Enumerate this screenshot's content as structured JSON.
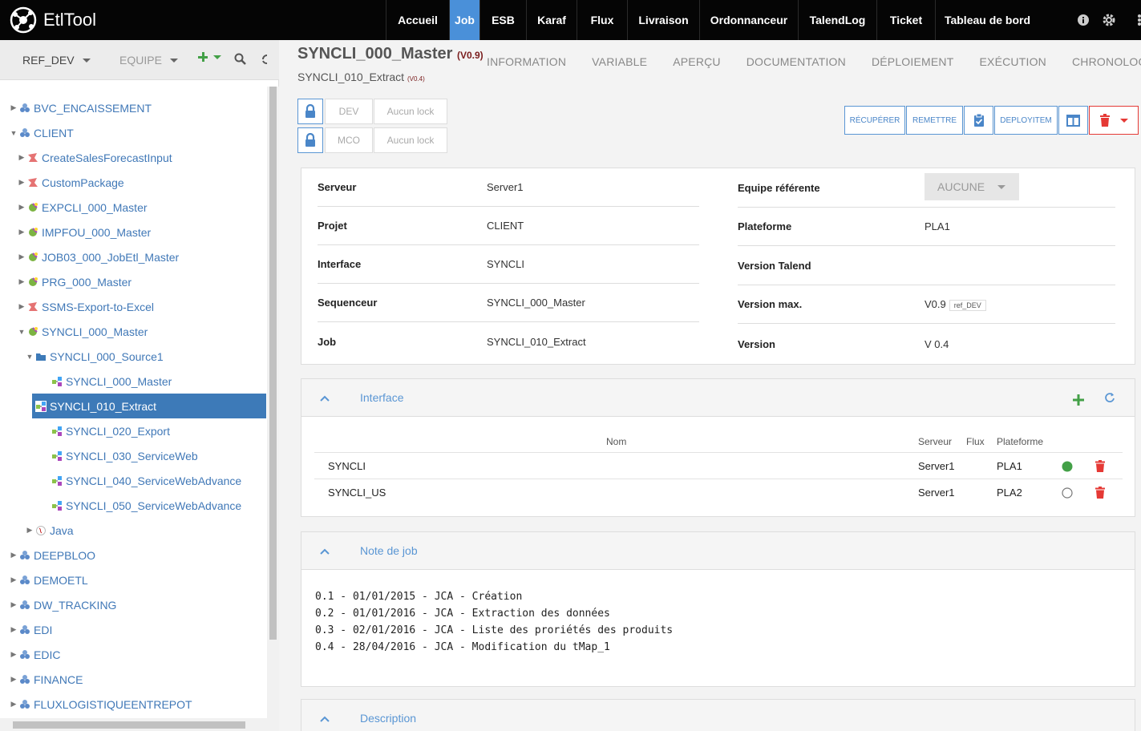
{
  "app": {
    "name": "EtlTool"
  },
  "nav": {
    "items": [
      "Accueil",
      "Job",
      "ESB",
      "Karaf",
      "Flux",
      "Livraison",
      "Ordonnanceur",
      "TalendLog",
      "Ticket",
      "Tableau de bord"
    ],
    "active": "Job",
    "icons": [
      "info-icon",
      "gear-icon"
    ]
  },
  "sidebar": {
    "branch_label": "REF_DEV",
    "team_label": "EQUIPE",
    "tree": [
      {
        "label": "BVC_ENCAISSEMENT",
        "icon": "project-icon",
        "expanded": false
      },
      {
        "label": "CLIENT",
        "icon": "project-icon",
        "expanded": true
      },
      {
        "label": "CreateSalesForecastInput",
        "icon": "esb-icon",
        "expanded": false
      },
      {
        "label": "CustomPackage",
        "icon": "esb-icon",
        "expanded": false
      },
      {
        "label": "EXPCLI_000_Master",
        "icon": "master-icon",
        "expanded": false
      },
      {
        "label": "IMPFOU_000_Master",
        "icon": "master-icon",
        "expanded": false
      },
      {
        "label": "JOB03_000_JobEtl_Master",
        "icon": "master-icon",
        "expanded": false
      },
      {
        "label": "PRG_000_Master",
        "icon": "master-icon",
        "expanded": false
      },
      {
        "label": "SSMS-Export-to-Excel",
        "icon": "esb-icon",
        "expanded": false
      },
      {
        "label": "SYNCLI_000_Master",
        "icon": "master-icon",
        "expanded": true
      },
      {
        "label": "SYNCLI_000_Source1",
        "icon": "folder-icon",
        "expanded": true
      },
      {
        "label": "SYNCLI_000_Master",
        "icon": "job-icon",
        "expanded": false
      },
      {
        "label": "SYNCLI_010_Extract",
        "icon": "job-icon",
        "expanded": false,
        "selected": true
      },
      {
        "label": "SYNCLI_020_Export",
        "icon": "job-icon",
        "expanded": false
      },
      {
        "label": "SYNCLI_030_ServiceWeb",
        "icon": "job-icon",
        "expanded": false
      },
      {
        "label": "SYNCLI_040_ServiceWebAdvance",
        "icon": "job-icon",
        "expanded": false
      },
      {
        "label": "SYNCLI_050_ServiceWebAdvance",
        "icon": "job-icon",
        "expanded": false
      },
      {
        "label": "Java",
        "icon": "java-icon",
        "expanded": false
      },
      {
        "label": "DEEPBLOO",
        "icon": "project-icon",
        "expanded": false
      },
      {
        "label": "DEMOETL",
        "icon": "project-icon",
        "expanded": false
      },
      {
        "label": "DW_TRACKING",
        "icon": "project-icon",
        "expanded": false
      },
      {
        "label": "EDI",
        "icon": "project-icon",
        "expanded": false
      },
      {
        "label": "EDIC",
        "icon": "project-icon",
        "expanded": false
      },
      {
        "label": "FINANCE",
        "icon": "project-icon",
        "expanded": false
      },
      {
        "label": "FLUXLOGISTIQUEENTREPOT",
        "icon": "project-icon",
        "expanded": false
      }
    ]
  },
  "header": {
    "title": "SYNCLI_000_Master",
    "title_version": "(V0.9)",
    "subtitle": "SYNCLI_010_Extract",
    "subtitle_version": "(V0.4)",
    "tabs": [
      "INFORMATION",
      "VARIABLE",
      "APERÇU",
      "DOCUMENTATION",
      "DÉPLOIEMENT",
      "EXÉCUTION",
      "CHRONOLOGIE"
    ]
  },
  "locks": [
    {
      "env": "DEV",
      "state": "Aucun lock"
    },
    {
      "env": "MCO",
      "state": "Aucun lock"
    }
  ],
  "actions": {
    "recuperer": "RÉCUPÉRER",
    "remettre": "REMETTRE",
    "deployitem": "DEPLOYITEM"
  },
  "info": {
    "left": [
      {
        "label": "Serveur",
        "value": "Server1"
      },
      {
        "label": "Projet",
        "value": "CLIENT"
      },
      {
        "label": "Interface",
        "value": "SYNCLI"
      },
      {
        "label": "Sequenceur",
        "value": "SYNCLI_000_Master"
      },
      {
        "label": "Job",
        "value": "SYNCLI_010_Extract"
      }
    ],
    "right": [
      {
        "label": "Equipe référente",
        "value": "AUCUNE"
      },
      {
        "label": "Plateforme",
        "value": "PLA1"
      },
      {
        "label": "Version Talend",
        "value": ""
      },
      {
        "label": "Version max.",
        "value": "V0.9",
        "badge": "ref_DEV"
      },
      {
        "label": "Version",
        "value": "V 0.4"
      }
    ]
  },
  "interface_panel": {
    "title": "Interface",
    "columns": [
      "Nom",
      "Serveur",
      "Flux",
      "Plateforme"
    ],
    "rows": [
      {
        "nom": "SYNCLI",
        "serveur": "Server1",
        "flux": "",
        "plateforme": "PLA1",
        "active": true
      },
      {
        "nom": "SYNCLI_US",
        "serveur": "Server1",
        "flux": "",
        "plateforme": "PLA2",
        "active": false
      }
    ]
  },
  "note_panel": {
    "title": "Note de job",
    "lines": [
      "0.1 - 01/01/2015 - JCA - Création",
      "0.2 - 01/01/2016 - JCA - Extraction des données",
      "0.3 - 02/01/2016 - JCA - Liste des proriétés des produits",
      "0.4 - 28/04/2016 - JCA - Modification du tMap_1"
    ]
  },
  "description_panel": {
    "title": "Description"
  },
  "colors": {
    "accent": "#4a90d9",
    "link": "#4078b7",
    "danger": "#e53935",
    "success": "#43a047"
  }
}
